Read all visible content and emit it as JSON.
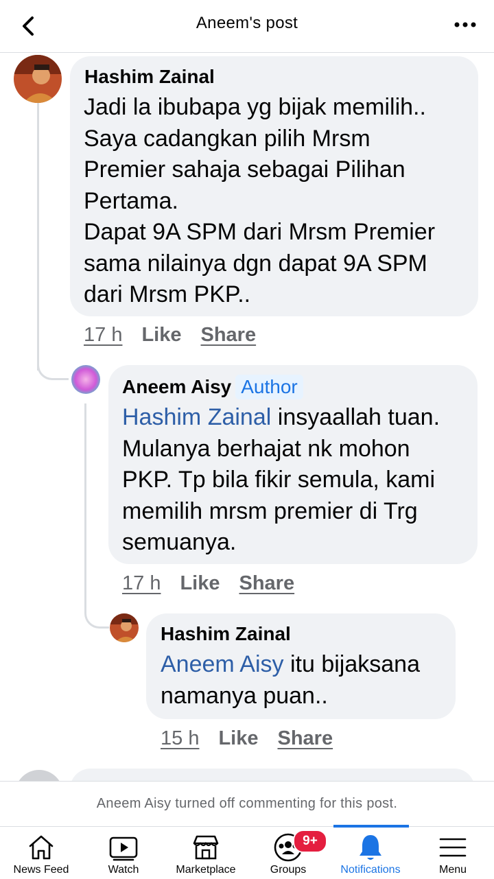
{
  "header": {
    "title": "Aneem's post"
  },
  "comments": [
    {
      "author": "Hashim Zainal",
      "text": "Jadi la ibubapa yg bijak memilih..\nSaya cadangkan pilih Mrsm\nPremier sahaja sebagai Pilihan\nPertama.\nDapat 9A SPM dari Mrsm Premier\nsama nilainya dgn dapat 9A SPM\ndari Mrsm PKP..",
      "lines": [
        "Jadi la ibubapa yg bijak memilih..",
        "Saya cadangkan pilih Mrsm",
        "Premier sahaja sebagai Pilihan",
        "Pertama.",
        "Dapat 9A SPM dari Mrsm Premier",
        "sama nilainya dgn dapat 9A SPM",
        "dari Mrsm PKP.."
      ],
      "time": "17 h",
      "like": "Like",
      "share": "Share"
    },
    {
      "author": "Aneem Aisy",
      "badge": "Author",
      "mention": "Hashim Zainal",
      "lines": [
        " insyaallah tuan.",
        "Mulanya berhajat nk mohon",
        "PKP. Tp bila fikir semula, kami",
        "memilih mrsm premier di Trg",
        "semuanya."
      ],
      "time": "17 h",
      "like": "Like",
      "share": "Share"
    },
    {
      "author": "Hashim Zainal",
      "mention": "Aneem Aisy",
      "lines": [
        " itu bijaksana",
        "namanya puan.."
      ],
      "time": "15 h",
      "like": "Like",
      "share": "Share"
    }
  ],
  "notice": "Aneem Aisy turned off commenting for this post.",
  "tabs": [
    {
      "label": "News Feed",
      "icon": "home-icon"
    },
    {
      "label": "Watch",
      "icon": "watch-icon"
    },
    {
      "label": "Marketplace",
      "icon": "marketplace-icon"
    },
    {
      "label": "Groups",
      "icon": "groups-icon",
      "badge": "9+"
    },
    {
      "label": "Notifications",
      "icon": "bell-icon",
      "active": true
    },
    {
      "label": "Menu",
      "icon": "menu-icon"
    }
  ],
  "colors": {
    "accent": "#1b74e4",
    "mention": "#2d5ea7",
    "badge": "#e41e3f",
    "bubble": "#f0f2f5"
  }
}
